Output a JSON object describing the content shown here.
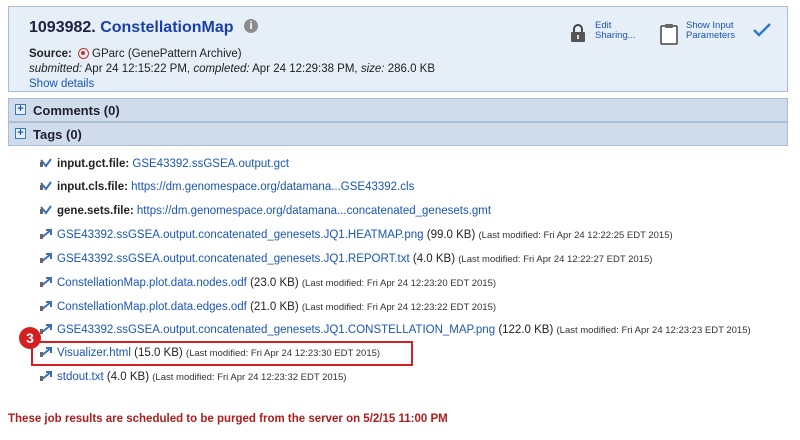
{
  "job": {
    "number": "1093982.",
    "name": "ConstellationMap",
    "source_label": "Source:",
    "source_value": "GParc (GenePattern Archive)",
    "submitted_label": "submitted:",
    "submitted_value": "Apr 24 12:15:22 PM,",
    "completed_label": "completed:",
    "completed_value": "Apr 24 12:29:38 PM,",
    "size_label": "size:",
    "size_value": "286.0 KB",
    "show_details": "Show details"
  },
  "header_actions": {
    "edit_line1": "Edit",
    "edit_line2": "Sharing...",
    "show_input_line1": "Show Input",
    "show_input_line2": "Parameters",
    "check_color": "#2e7ad1"
  },
  "sections": {
    "comments": "Comments (0)",
    "tags": "Tags (0)"
  },
  "inputs": [
    {
      "param": "input.gct.file:",
      "value": "GSE43392.ssGSEA.output.gct"
    },
    {
      "param": "input.cls.file:",
      "value": "https://dm.genomespace.org/datamana...GSE43392.cls"
    },
    {
      "param": "gene.sets.file:",
      "value": "https://dm.genomespace.org/datamana...concatenated_genesets.gmt"
    }
  ],
  "outputs": [
    {
      "name": "GSE43392.ssGSEA.output.concatenated_genesets.JQ1.HEATMAP.png",
      "size": "(99.0 KB)",
      "modified": "(Last modified: Fri Apr 24 12:22:25 EDT 2015)"
    },
    {
      "name": "GSE43392.ssGSEA.output.concatenated_genesets.JQ1.REPORT.txt",
      "size": "(4.0 KB)",
      "modified": "(Last modified: Fri Apr 24 12:22:27 EDT 2015)"
    },
    {
      "name": "ConstellationMap.plot.data.nodes.odf",
      "size": "(23.0 KB)",
      "modified": "(Last modified: Fri Apr 24 12:23:20 EDT 2015)"
    },
    {
      "name": "ConstellationMap.plot.data.edges.odf",
      "size": "(21.0 KB)",
      "modified": "(Last modified: Fri Apr 24 12:23:22 EDT 2015)"
    },
    {
      "name": "GSE43392.ssGSEA.output.concatenated_genesets.JQ1.CONSTELLATION_MAP.png",
      "size": "(122.0 KB)",
      "modified": "(Last modified: Fri Apr 24 12:23:23 EDT 2015)"
    },
    {
      "name": "Visualizer.html",
      "size": "(15.0 KB)",
      "modified": "(Last modified: Fri Apr 24 12:23:30 EDT 2015)"
    },
    {
      "name": "stdout.txt",
      "size": "(4.0 KB)",
      "modified": "(Last modified: Fri Apr 24 12:23:32 EDT 2015)"
    }
  ],
  "annotation": {
    "step_number": "3",
    "color": "#d42020"
  },
  "purge_note": "These job results are scheduled to be purged from the server on 5/2/15 11:00 PM"
}
